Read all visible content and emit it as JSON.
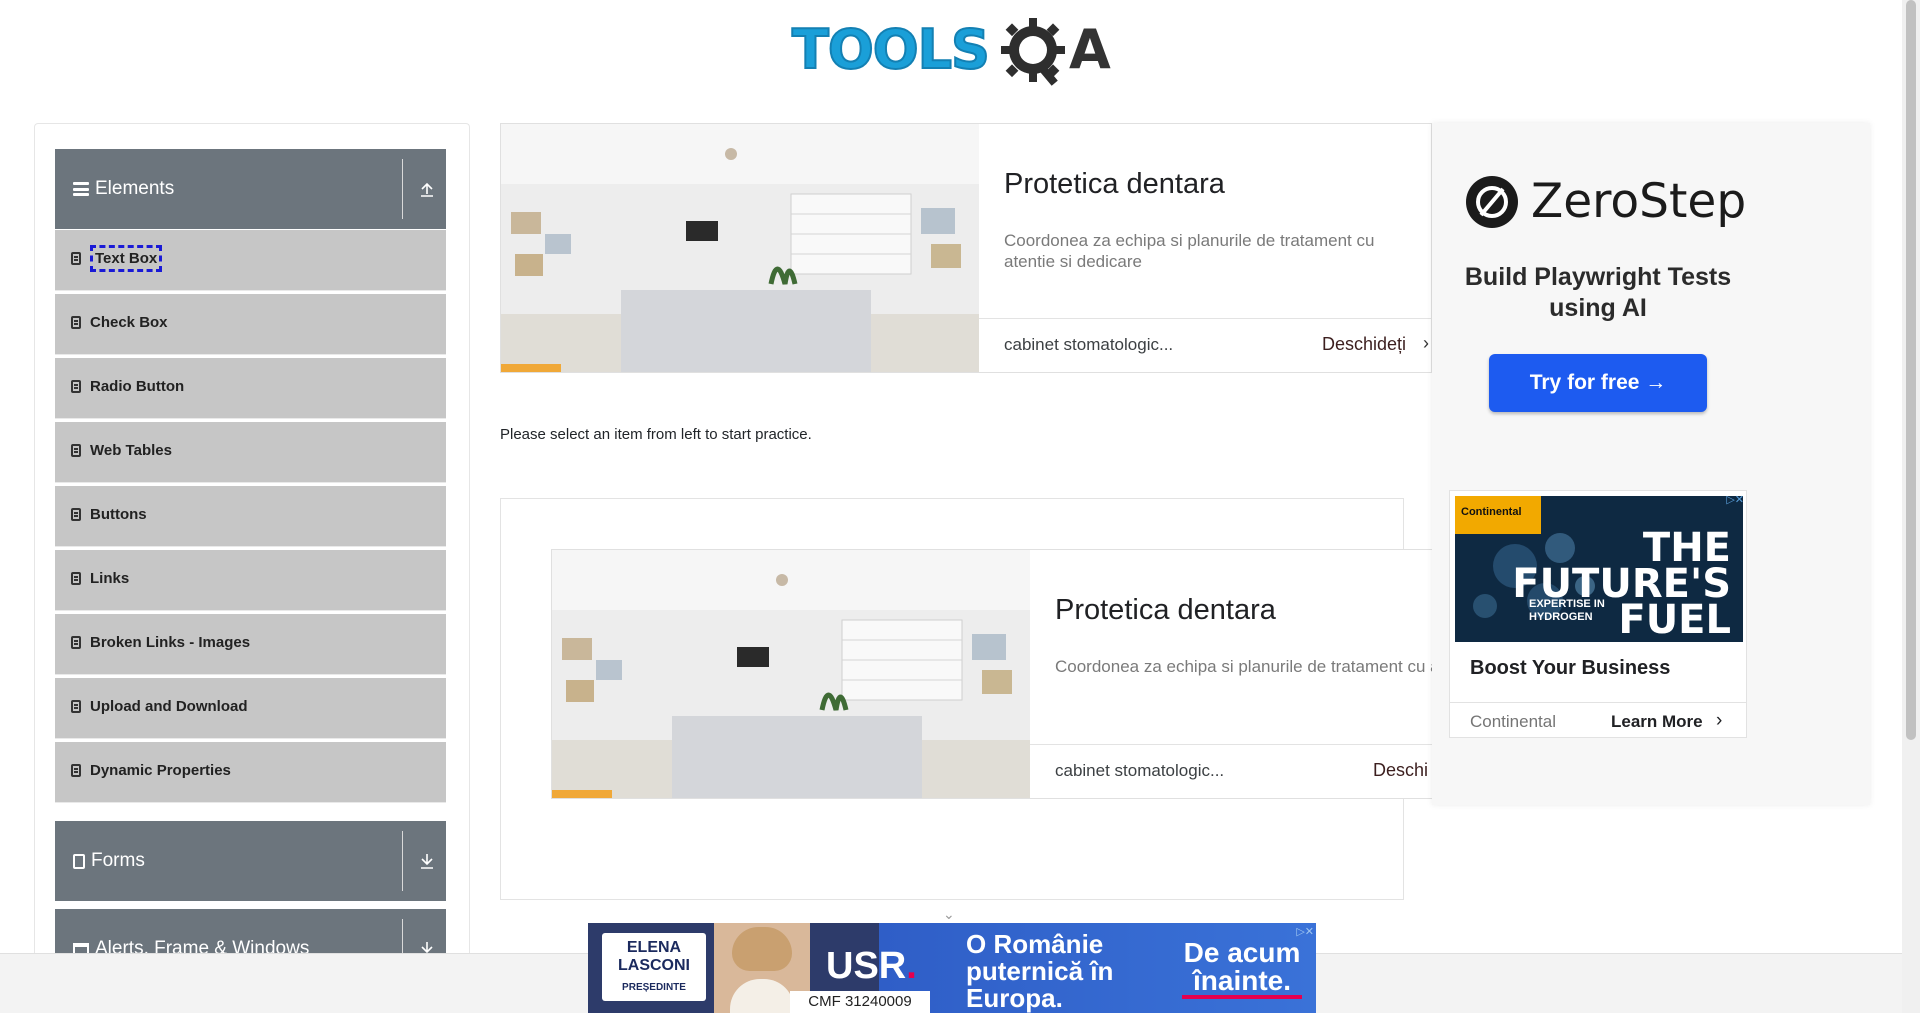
{
  "brand": {
    "logo_text": "TOOLS",
    "logo_suffix": "A",
    "logo_gear_letter": "Q"
  },
  "sidebar": {
    "groups": [
      {
        "label": "Elements",
        "expanded": true
      },
      {
        "label": "Forms",
        "expanded": false
      },
      {
        "label": "Alerts, Frame & Windows",
        "expanded": false
      }
    ],
    "items": [
      {
        "label": "Text Box",
        "active": true
      },
      {
        "label": "Check Box"
      },
      {
        "label": "Radio Button"
      },
      {
        "label": "Web Tables"
      },
      {
        "label": "Buttons"
      },
      {
        "label": "Links"
      },
      {
        "label": "Broken Links - Images"
      },
      {
        "label": "Upload and Download"
      },
      {
        "label": "Dynamic Properties"
      }
    ]
  },
  "main": {
    "practice_text": "Please select an item from left to start practice.",
    "top_ad": {
      "title": "Protetica dentara",
      "description": "Coordonea za echipa si planurile de tratament cu atentie si dedicare",
      "source": "cabinet stomatologic...",
      "cta": "Deschideți"
    },
    "inner_ad": {
      "title": "Protetica dentara",
      "description": "Coordonea za echipa si planurile de tratament cu atentie si dedicare",
      "source": "cabinet stomatologic...",
      "cta": "Deschi"
    }
  },
  "right_ad": {
    "brand": "ZeroStep",
    "tagline": "Build Playwright Tests using AI",
    "cta": "Try for free →"
  },
  "continental_ad": {
    "logo": "Continental",
    "headline_1": "THE",
    "headline_2": "FUTURE'S",
    "headline_3": "FUEL",
    "sub": "EXPERTISE IN HYDROGEN",
    "title": "Boost Your Business",
    "source": "Continental",
    "cta": "Learn More"
  },
  "bottom_ad": {
    "name": "ELENA LASCONI",
    "role": "PREȘEDINTE",
    "party": "USR",
    "cmf": "CMF 31240009",
    "slogan": "O Românie puternică în Europa.",
    "right": "De acum înainte."
  },
  "colors": {
    "sidebar_header": "#6c757d",
    "sidebar_item": "#c6c6c6",
    "logo_blue": "#1a9fd8",
    "cta_blue": "#1d5bf0"
  }
}
